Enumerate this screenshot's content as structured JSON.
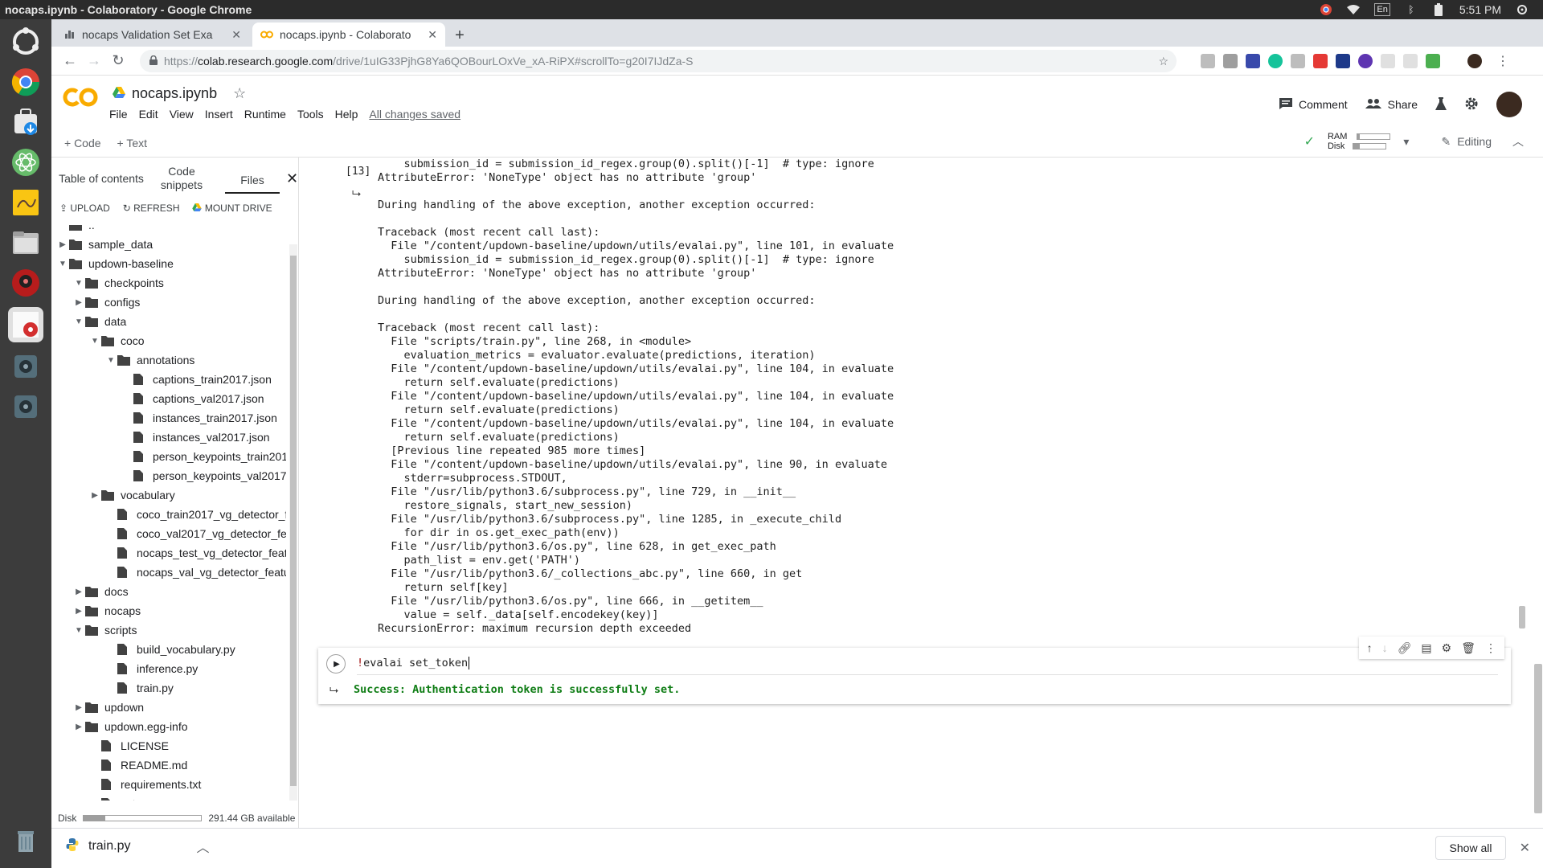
{
  "os": {
    "window_title": "nocaps.ipynb - Colaboratory - Google Chrome",
    "lang": "En",
    "time": "5:51 PM"
  },
  "tabs": [
    {
      "title": "nocaps Validation Set Exa",
      "active": false
    },
    {
      "title": "nocaps.ipynb - Colaborato",
      "active": true
    }
  ],
  "address": {
    "scheme": "https://",
    "host": "colab.research.google.com",
    "path": "/drive/1uIG33PjhG8Ya6QOBourLOxVe_xA-RiPX#scrollTo=g20I7IJdZa-S"
  },
  "colab": {
    "logo_text": "CO",
    "notebook_title": "nocaps.ipynb",
    "menu": [
      "File",
      "Edit",
      "View",
      "Insert",
      "Runtime",
      "Tools",
      "Help"
    ],
    "saved_status": "All changes saved",
    "comment_label": "Comment",
    "share_label": "Share",
    "add_code_label": "+ Code",
    "add_text_label": "+ Text",
    "ram_label": "RAM",
    "disk_label": "Disk",
    "editing_label": "Editing"
  },
  "sidebar": {
    "tabs": [
      "Table of contents",
      "Code snippets",
      "Files"
    ],
    "actions": [
      "UPLOAD",
      "REFRESH",
      "MOUNT DRIVE"
    ],
    "tree": [
      {
        "name": "..",
        "depth": 0,
        "type": "folder-up",
        "toggle": ""
      },
      {
        "name": "sample_data",
        "depth": 0,
        "type": "folder",
        "toggle": "right"
      },
      {
        "name": "updown-baseline",
        "depth": 0,
        "type": "folder",
        "toggle": "down"
      },
      {
        "name": "checkpoints",
        "depth": 1,
        "type": "folder",
        "toggle": "down"
      },
      {
        "name": "configs",
        "depth": 1,
        "type": "folder",
        "toggle": "right"
      },
      {
        "name": "data",
        "depth": 1,
        "type": "folder",
        "toggle": "down"
      },
      {
        "name": "coco",
        "depth": 2,
        "type": "folder",
        "toggle": "down"
      },
      {
        "name": "annotations",
        "depth": 3,
        "type": "folder",
        "toggle": "down"
      },
      {
        "name": "captions_train2017.json",
        "depth": 4,
        "type": "file",
        "toggle": ""
      },
      {
        "name": "captions_val2017.json",
        "depth": 4,
        "type": "file",
        "toggle": ""
      },
      {
        "name": "instances_train2017.json",
        "depth": 4,
        "type": "file",
        "toggle": ""
      },
      {
        "name": "instances_val2017.json",
        "depth": 4,
        "type": "file",
        "toggle": ""
      },
      {
        "name": "person_keypoints_train201...",
        "depth": 4,
        "type": "file",
        "toggle": ""
      },
      {
        "name": "person_keypoints_val2017....",
        "depth": 4,
        "type": "file",
        "toggle": ""
      },
      {
        "name": "vocabulary",
        "depth": 2,
        "type": "folder",
        "toggle": "right"
      },
      {
        "name": "coco_train2017_vg_detector_f...",
        "depth": 3,
        "type": "file",
        "toggle": ""
      },
      {
        "name": "coco_val2017_vg_detector_fe...",
        "depth": 3,
        "type": "file",
        "toggle": ""
      },
      {
        "name": "nocaps_test_vg_detector_feat...",
        "depth": 3,
        "type": "file",
        "toggle": ""
      },
      {
        "name": "nocaps_val_vg_detector_featu...",
        "depth": 3,
        "type": "file",
        "toggle": ""
      },
      {
        "name": "docs",
        "depth": 1,
        "type": "folder",
        "toggle": "right"
      },
      {
        "name": "nocaps",
        "depth": 1,
        "type": "folder",
        "toggle": "right"
      },
      {
        "name": "scripts",
        "depth": 1,
        "type": "folder",
        "toggle": "down"
      },
      {
        "name": "build_vocabulary.py",
        "depth": 3,
        "type": "file",
        "toggle": ""
      },
      {
        "name": "inference.py",
        "depth": 3,
        "type": "file",
        "toggle": ""
      },
      {
        "name": "train.py",
        "depth": 3,
        "type": "file",
        "toggle": ""
      },
      {
        "name": "updown",
        "depth": 1,
        "type": "folder",
        "toggle": "right"
      },
      {
        "name": "updown.egg-info",
        "depth": 1,
        "type": "folder",
        "toggle": "right"
      },
      {
        "name": "LICENSE",
        "depth": 2,
        "type": "file",
        "toggle": ""
      },
      {
        "name": "README.md",
        "depth": 2,
        "type": "file",
        "toggle": ""
      },
      {
        "name": "requirements.txt",
        "depth": 2,
        "type": "file",
        "toggle": ""
      },
      {
        "name": "setup.py",
        "depth": 2,
        "type": "file",
        "toggle": ""
      }
    ],
    "disk_label": "Disk",
    "disk_available": "291.44 GB available"
  },
  "cell1": {
    "exec_count": "[13]",
    "output": "    submission_id = submission_id_regex.group(0).split()[-1]  # type: ignore\nAttributeError: 'NoneType' object has no attribute 'group'\n\nDuring handling of the above exception, another exception occurred:\n\nTraceback (most recent call last):\n  File \"/content/updown-baseline/updown/utils/evalai.py\", line 101, in evaluate\n    submission_id = submission_id_regex.group(0).split()[-1]  # type: ignore\nAttributeError: 'NoneType' object has no attribute 'group'\n\nDuring handling of the above exception, another exception occurred:\n\nTraceback (most recent call last):\n  File \"scripts/train.py\", line 268, in <module>\n    evaluation_metrics = evaluator.evaluate(predictions, iteration)\n  File \"/content/updown-baseline/updown/utils/evalai.py\", line 104, in evaluate\n    return self.evaluate(predictions)\n  File \"/content/updown-baseline/updown/utils/evalai.py\", line 104, in evaluate\n    return self.evaluate(predictions)\n  File \"/content/updown-baseline/updown/utils/evalai.py\", line 104, in evaluate\n    return self.evaluate(predictions)\n  [Previous line repeated 985 more times]\n  File \"/content/updown-baseline/updown/utils/evalai.py\", line 90, in evaluate\n    stderr=subprocess.STDOUT,\n  File \"/usr/lib/python3.6/subprocess.py\", line 729, in __init__\n    restore_signals, start_new_session)\n  File \"/usr/lib/python3.6/subprocess.py\", line 1285, in _execute_child\n    for dir in os.get_exec_path(env))\n  File \"/usr/lib/python3.6/os.py\", line 628, in get_exec_path\n    path_list = env.get('PATH')\n  File \"/usr/lib/python3.6/_collections_abc.py\", line 660, in get\n    return self[key]\n  File \"/usr/lib/python3.6/os.py\", line 666, in __getitem__\n    value = self._data[self.encodekey(key)]\nRecursionError: maximum recursion depth exceeded"
  },
  "cell2": {
    "code_bang": "!",
    "code_rest": "evalai set_token ",
    "output": "Success: Authentication token is successfully set."
  },
  "shelf": {
    "download_name": "train.py",
    "show_all": "Show all"
  },
  "colors": {
    "colab_orange": "#f9ab00",
    "success_green": "#0f7d15"
  }
}
